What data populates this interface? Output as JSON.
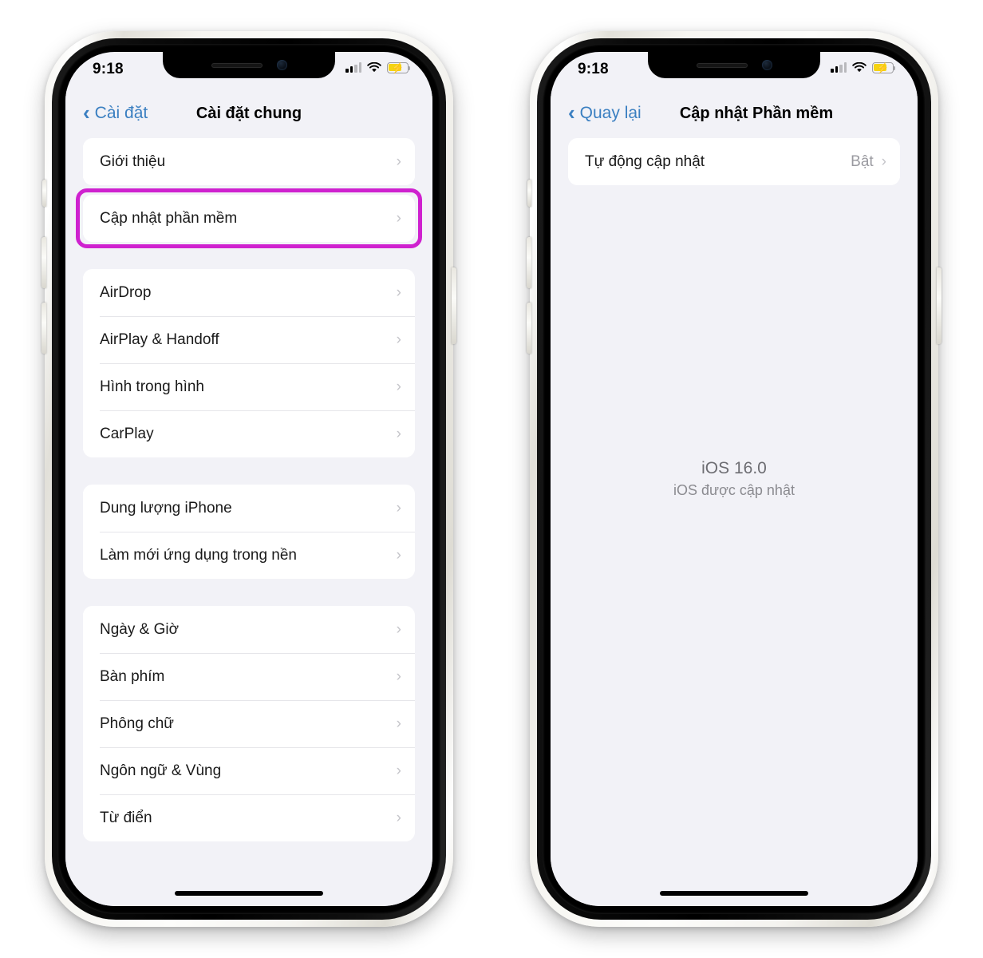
{
  "phones": [
    {
      "id": "phone-general-settings",
      "status_bar": {
        "time": "9:18",
        "signal_icon": "cellular-signal-icon",
        "wifi_icon": "wifi-icon",
        "battery_icon": "battery-charging-icon"
      },
      "nav": {
        "back_label": "Cài đặt",
        "back_icon": "chevron-left-icon",
        "title": "Cài đặt chung"
      },
      "groups": [
        {
          "rows": [
            {
              "label": "Giới thiệu",
              "value": "",
              "chevron": "›",
              "highlighted": false
            },
            {
              "label": "Cập nhật phần mềm",
              "value": "",
              "chevron": "›",
              "highlighted": true
            }
          ]
        },
        {
          "rows": [
            {
              "label": "AirDrop",
              "value": "",
              "chevron": "›",
              "highlighted": false
            },
            {
              "label": "AirPlay & Handoff",
              "value": "",
              "chevron": "›",
              "highlighted": false
            },
            {
              "label": "Hình trong hình",
              "value": "",
              "chevron": "›",
              "highlighted": false
            },
            {
              "label": "CarPlay",
              "value": "",
              "chevron": "›",
              "highlighted": false
            }
          ]
        },
        {
          "rows": [
            {
              "label": "Dung lượng iPhone",
              "value": "",
              "chevron": "›",
              "highlighted": false
            },
            {
              "label": "Làm mới ứng dụng trong nền",
              "value": "",
              "chevron": "›",
              "highlighted": false
            }
          ]
        },
        {
          "rows": [
            {
              "label": "Ngày & Giờ",
              "value": "",
              "chevron": "›",
              "highlighted": false
            },
            {
              "label": "Bàn phím",
              "value": "",
              "chevron": "›",
              "highlighted": false
            },
            {
              "label": "Phông chữ",
              "value": "",
              "chevron": "›",
              "highlighted": false
            },
            {
              "label": "Ngôn ngữ & Vùng",
              "value": "",
              "chevron": "›",
              "highlighted": false
            },
            {
              "label": "Từ điển",
              "value": "",
              "chevron": "›",
              "highlighted": false
            }
          ]
        }
      ],
      "center_status": null
    },
    {
      "id": "phone-software-update",
      "status_bar": {
        "time": "9:18",
        "signal_icon": "cellular-signal-icon",
        "wifi_icon": "wifi-icon",
        "battery_icon": "battery-charging-icon"
      },
      "nav": {
        "back_label": "Quay lại",
        "back_icon": "chevron-left-icon",
        "title": "Cập nhật Phần mềm"
      },
      "groups": [
        {
          "rows": [
            {
              "label": "Tự động cập nhật",
              "value": "Bật",
              "chevron": "›",
              "highlighted": false
            }
          ]
        }
      ],
      "center_status": {
        "title": "iOS 16.0",
        "subtitle": "iOS được cập nhật"
      }
    }
  ],
  "colors": {
    "highlight_box": "#cf21cf",
    "link_blue": "#3a7fc1",
    "screen_background": "#f2f2f7",
    "card_background": "#ffffff",
    "battery_fill": "#f5d312",
    "chevron_gray": "#c4c4c9",
    "value_gray": "#9a9aa0"
  }
}
